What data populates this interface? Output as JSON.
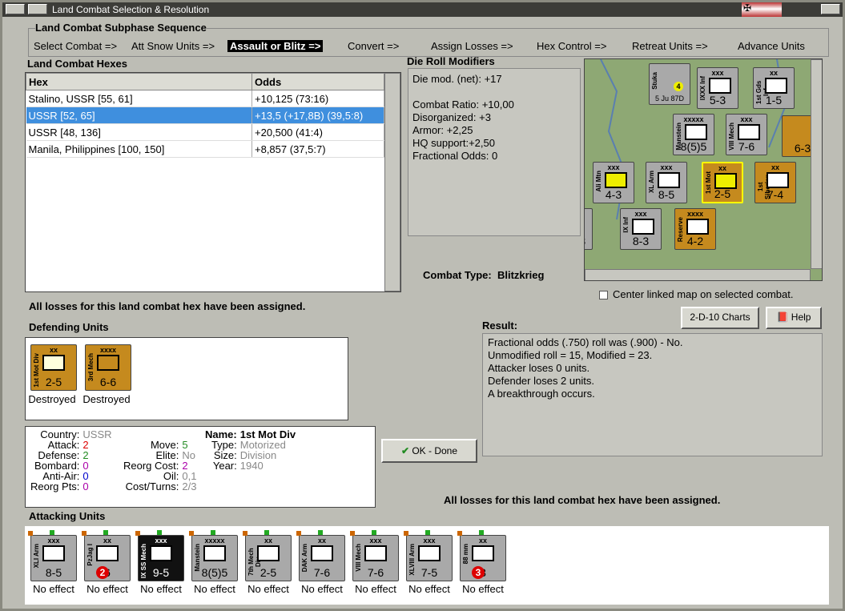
{
  "window": {
    "title": "Land Combat Selection & Resolution"
  },
  "subphase": {
    "title": "Land Combat Subphase Sequence",
    "steps": [
      "Select Combat =>",
      "Att Snow Units =>",
      "Assault or Blitz =>",
      "Convert =>",
      "Assign Losses =>",
      "Hex Control =>",
      "Retreat Units =>",
      "Advance Units"
    ]
  },
  "hexes": {
    "title": "Land Combat Hexes",
    "columns": [
      "Hex",
      "Odds"
    ],
    "rows": [
      {
        "hex": "Stalino, USSR [55, 61]",
        "odds": "+10,125 (73:16)"
      },
      {
        "hex": "USSR [52, 65]",
        "odds": "+13,5 (+17,8B) (39,5:8)"
      },
      {
        "hex": "USSR [48, 136]",
        "odds": "+20,500 (41:4)"
      },
      {
        "hex": "Manila, Philippines [100, 150]",
        "odds": "+8,857 (37,5:7)"
      }
    ],
    "selected_index": 1
  },
  "modifiers": {
    "title": "Die Roll Modifiers",
    "lines": [
      "Die mod. (net): +17",
      "",
      "Combat Ratio: +10,00",
      "Disorganized: +3",
      "Armor: +2,25",
      "HQ support:+2,50",
      "Fractional Odds: 0"
    ]
  },
  "combat_type": {
    "label": "Combat Type:",
    "value": "Blitzkrieg"
  },
  "center_map": {
    "label": "Center linked map on selected combat.",
    "checked": false
  },
  "buttons": {
    "charts": "2-D-10 Charts",
    "help": "Help",
    "ok": "OK - Done"
  },
  "losses_msg": "All losses for this land combat hex have been assigned.",
  "defending": {
    "title": "Defending Units",
    "units": [
      {
        "size": "xx",
        "side": "1st Mot Div",
        "str": "2-5",
        "status": "Destroyed"
      },
      {
        "size": "xxxx",
        "side": "3rd Mech",
        "str": "6-6",
        "status": "Destroyed"
      }
    ]
  },
  "result": {
    "title": "Result:",
    "lines": [
      "Fractional odds (.750) roll was (.900)  - No.",
      "Unmodified roll = 15, Modified = 23.",
      "Attacker loses 0 units.",
      "Defender loses 2 units.",
      "A breakthrough occurs."
    ]
  },
  "info": {
    "country_l": "Country:",
    "country": "USSR",
    "attack_l": "Attack:",
    "attack": "2",
    "defense_l": "Defense:",
    "defense": "2",
    "bombard_l": "Bombard:",
    "bombard": "0",
    "antiair_l": "Anti-Air:",
    "antiair": "0",
    "reorgpts_l": "Reorg Pts:",
    "reorgpts": "0",
    "move_l": "Move:",
    "move": "5",
    "elite_l": "Elite:",
    "elite": "No",
    "reorgcost_l": "Reorg Cost:",
    "reorgcost": "2",
    "oil_l": "Oil:",
    "oil": "0,1",
    "costturns_l": "Cost/Turns:",
    "costturns": "2/3",
    "name_l": "Name:",
    "name": "1st Mot Div",
    "type_l": "Type:",
    "type": "Motorized",
    "size_l": "Size:",
    "size": "Division",
    "year_l": "Year:",
    "year": "1940"
  },
  "attacking": {
    "title": "Attacking Units",
    "units": [
      {
        "size": "xxx",
        "side": "XLI Arm",
        "str": "8-5",
        "status": "No effect",
        "color": "grey"
      },
      {
        "size": "xx",
        "side": "PzJag I",
        "str": "6",
        "badge": "2",
        "status": "No effect",
        "color": "grey"
      },
      {
        "size": "xxx",
        "side": "IX SS Mech",
        "str": "9-5",
        "status": "No effect",
        "color": "black"
      },
      {
        "size": "xxxxx",
        "side": "Manstein",
        "str": "8(5)5",
        "status": "No effect",
        "color": "grey"
      },
      {
        "size": "xx",
        "side": "7th Mech Div",
        "str": "2-5",
        "status": "No effect",
        "color": "grey"
      },
      {
        "size": "xx",
        "side": "DAK Arm",
        "str": "7-6",
        "status": "No effect",
        "color": "grey"
      },
      {
        "size": "xxx",
        "side": "VIII Mech",
        "str": "7-6",
        "status": "No effect",
        "color": "grey"
      },
      {
        "size": "xxx",
        "side": "XLVIII Arm",
        "str": "7-5",
        "status": "No effect",
        "color": "grey"
      },
      {
        "size": "xx",
        "side": "88 mm",
        "str": "3",
        "badge": "3",
        "status": "No effect",
        "color": "grey"
      }
    ]
  },
  "map": {
    "counters": [
      {
        "size": "",
        "side": "Stuka",
        "str": "5 Ju 87D",
        "badge": "4"
      },
      {
        "size": "xxx",
        "side": "IXXX Inf",
        "str": "5-3"
      },
      {
        "size": "xx",
        "side": "1st Gds Inf",
        "str": "1-5"
      },
      {
        "size": "xxxxx",
        "side": "Manstein",
        "str": "8(5)5"
      },
      {
        "size": "xxx",
        "side": "VIII Mech",
        "str": "7-6"
      },
      {
        "size": "",
        "side": "",
        "str": "6-3"
      },
      {
        "size": "xxx",
        "side": "Ali Mtn",
        "str": "4-3"
      },
      {
        "size": "xxx",
        "side": "XL Arm",
        "str": "8-5"
      },
      {
        "size": "xx",
        "side": "1st Mot",
        "str": "2-5"
      },
      {
        "size": "xx",
        "side": "1st Siberian",
        "str": "7-4"
      },
      {
        "size": "xxx",
        "side": "IX Inf",
        "str": "8-3"
      },
      {
        "size": "xxxx",
        "side": "Reserve",
        "str": "4-2"
      },
      {
        "size": "",
        "side": "",
        "str": "-3"
      }
    ]
  }
}
